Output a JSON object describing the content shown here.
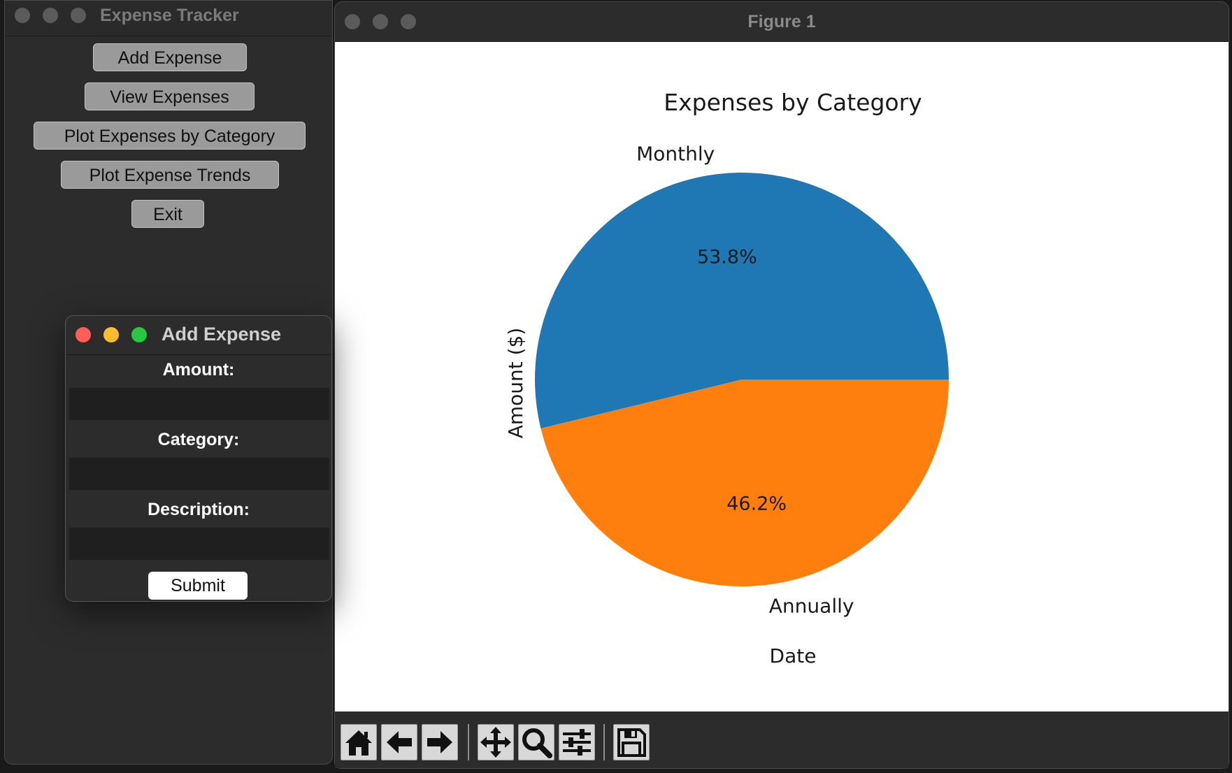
{
  "tracker": {
    "title": "Expense Tracker",
    "buttons": [
      {
        "label": "Add Expense"
      },
      {
        "label": "View Expenses"
      },
      {
        "label": "Plot Expenses by Category"
      },
      {
        "label": "Plot Expense Trends"
      },
      {
        "label": "Exit"
      }
    ]
  },
  "dialog": {
    "title": "Add Expense",
    "amount_label": "Amount:",
    "amount_value": "",
    "category_label": "Category:",
    "category_value": "",
    "description_label": "Description:",
    "description_value": "",
    "submit_label": "Submit",
    "light_colors": [
      "#ff5f57",
      "#febc2e",
      "#28c840"
    ]
  },
  "figure": {
    "window_title": "Figure 1",
    "toolbar": [
      {
        "icon": "home-icon"
      },
      {
        "icon": "back-arrow-icon"
      },
      {
        "icon": "forward-arrow-icon"
      },
      {
        "icon": "pan-icon"
      },
      {
        "icon": "zoom-icon"
      },
      {
        "icon": "configure-subplots-icon"
      },
      {
        "icon": "save-icon"
      }
    ]
  },
  "chart_data": {
    "type": "pie",
    "title": "Expenses by Category",
    "xlabel": "Date",
    "ylabel": "Amount ($)",
    "slices": [
      {
        "label": "Monthly",
        "percent": 53.8,
        "pct_label": "53.8%",
        "color": "#1f77b4"
      },
      {
        "label": "Annually",
        "percent": 46.2,
        "pct_label": "46.2%",
        "color": "#ff7f0e"
      }
    ],
    "startangle": 0,
    "counterclockwise": true
  }
}
